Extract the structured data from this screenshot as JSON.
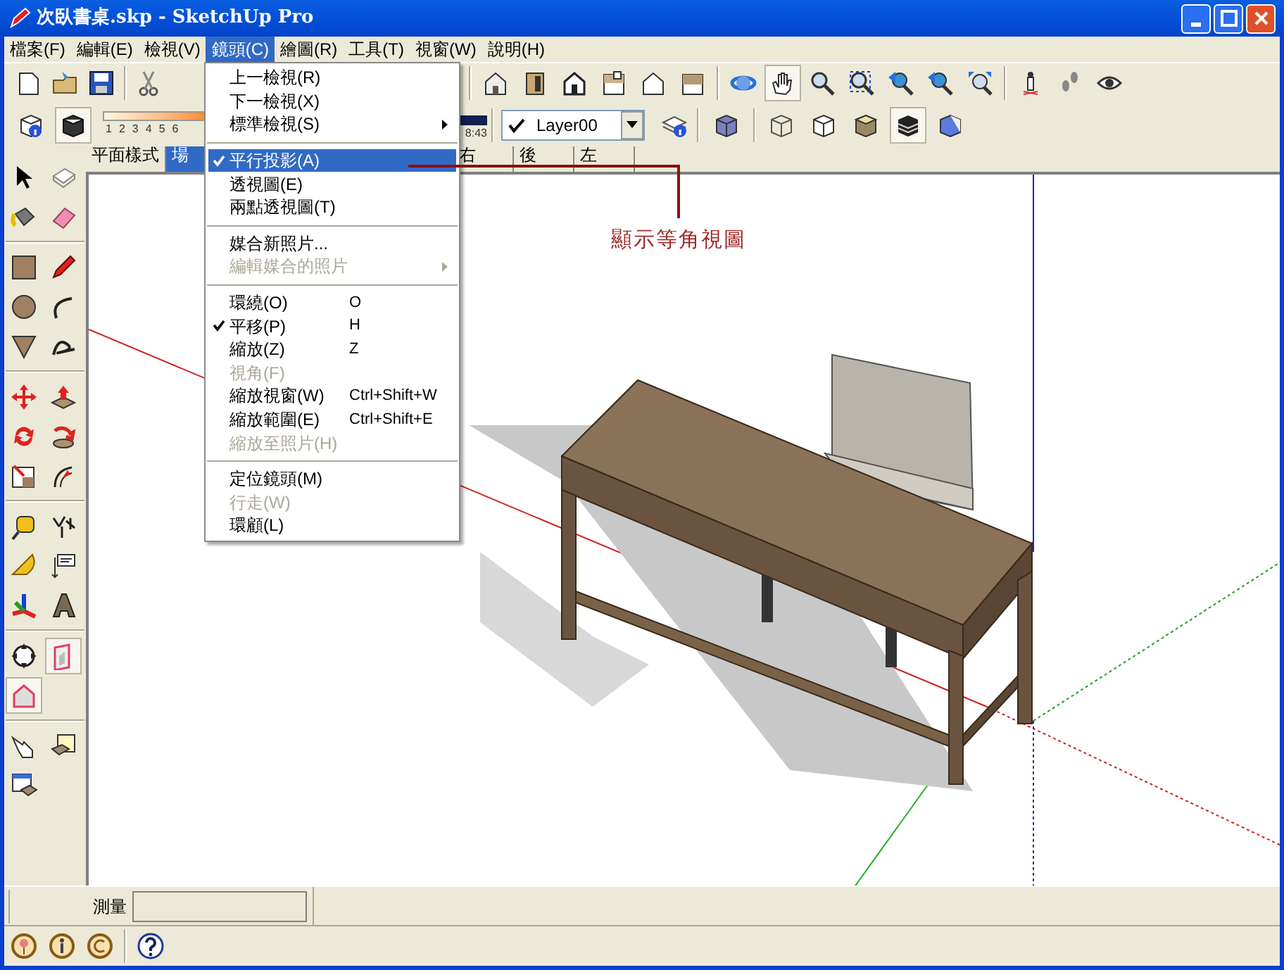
{
  "window": {
    "title": "次臥書桌.skp - SketchUp Pro"
  },
  "menu_bar": [
    {
      "label": "檔案(F)",
      "selected": false
    },
    {
      "label": "編輯(E)",
      "selected": false
    },
    {
      "label": "檢視(V)",
      "selected": false
    },
    {
      "label": "鏡頭(C)",
      "selected": true
    },
    {
      "label": "繪圖(R)",
      "selected": false
    },
    {
      "label": "工具(T)",
      "selected": false
    },
    {
      "label": "視窗(W)",
      "selected": false
    },
    {
      "label": "說明(H)",
      "selected": false
    }
  ],
  "shadow_slider": {
    "ticks": [
      "1",
      "2",
      "3",
      "4",
      "5",
      "6"
    ],
    "time": "8:43"
  },
  "layer_dropdown": {
    "value": "Layer00",
    "checked": true
  },
  "scene_tabs": [
    {
      "label": "平面樣式",
      "selected": false
    },
    {
      "label": "場",
      "selected": true
    },
    {
      "label": "右",
      "selected": false
    },
    {
      "label": "後",
      "selected": false
    },
    {
      "label": "左",
      "selected": false
    }
  ],
  "camera_menu": {
    "groups": [
      [
        {
          "label": "上一檢視(R)",
          "checked": false,
          "disabled": false,
          "selected": false,
          "submenu": false
        },
        {
          "label": "下一檢視(X)",
          "checked": false,
          "disabled": false,
          "selected": false,
          "submenu": false
        },
        {
          "label": "標準檢視(S)",
          "checked": false,
          "disabled": false,
          "selected": false,
          "submenu": true
        }
      ],
      [
        {
          "label": "平行投影(A)",
          "checked": true,
          "disabled": false,
          "selected": true,
          "submenu": false
        },
        {
          "label": "透視圖(E)",
          "checked": false,
          "disabled": false,
          "selected": false,
          "submenu": false
        },
        {
          "label": "兩點透視圖(T)",
          "checked": false,
          "disabled": false,
          "selected": false,
          "submenu": false
        }
      ],
      [
        {
          "label": "媒合新照片...",
          "checked": false,
          "disabled": false,
          "selected": false,
          "submenu": false
        },
        {
          "label": "編輯媒合的照片",
          "checked": false,
          "disabled": true,
          "selected": false,
          "submenu": true
        }
      ],
      [
        {
          "label": "環繞(O)",
          "shortcut": "O",
          "checked": false,
          "disabled": false,
          "selected": false,
          "submenu": false
        },
        {
          "label": "平移(P)",
          "shortcut": "H",
          "checked": true,
          "disabled": false,
          "selected": false,
          "submenu": false
        },
        {
          "label": "縮放(Z)",
          "shortcut": "Z",
          "checked": false,
          "disabled": false,
          "selected": false,
          "submenu": false
        },
        {
          "label": "視角(F)",
          "checked": false,
          "disabled": true,
          "selected": false,
          "submenu": false
        },
        {
          "label": "縮放視窗(W)",
          "shortcut": "Ctrl+Shift+W",
          "checked": false,
          "disabled": false,
          "selected": false,
          "submenu": false
        },
        {
          "label": "縮放範圍(E)",
          "shortcut": "Ctrl+Shift+E",
          "checked": false,
          "disabled": false,
          "selected": false,
          "submenu": false
        },
        {
          "label": "縮放至照片(H)",
          "checked": false,
          "disabled": true,
          "selected": false,
          "submenu": false
        }
      ],
      [
        {
          "label": "定位鏡頭(M)",
          "checked": false,
          "disabled": false,
          "selected": false,
          "submenu": false
        },
        {
          "label": "行走(W)",
          "checked": false,
          "disabled": true,
          "selected": false,
          "submenu": false
        },
        {
          "label": "環顧(L)",
          "checked": false,
          "disabled": false,
          "selected": false,
          "submenu": false
        }
      ]
    ]
  },
  "annotation": {
    "text": "顯示等角視圖"
  },
  "status_bar": {
    "measure_label": "測量"
  }
}
